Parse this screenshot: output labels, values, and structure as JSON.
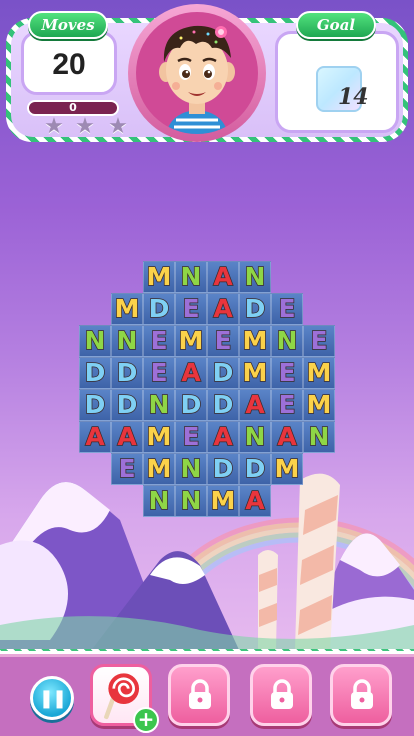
{
  "hud": {
    "moves_label": "Moves",
    "moves_value": "20",
    "score_value": "0",
    "score_progress": 0,
    "stars_total": 3,
    "goal_label": "Goal",
    "goal_count": "14"
  },
  "board": {
    "rows": [
      "..MNAN..",
      ".MDEADE.",
      "NNEMEMNE",
      "DDEADMEM",
      "DDNDDAEM",
      "AAMEANAN",
      ".EMNDDM.",
      "..NNMA.."
    ]
  },
  "colors": {
    "A": "#e8353d",
    "M": "#fbd24a",
    "N": "#8fd646",
    "E": "#9d70d8",
    "D": "#7fd0f4",
    "accent_green": "#1fa752",
    "cell_blue": "#4a72b8"
  },
  "bottom": {
    "pause_icon": "pause-icon",
    "booster_icon": "lollipop-icon",
    "add_icon": "plus-icon",
    "plus_glyph": "+",
    "locked_slots": 3
  }
}
